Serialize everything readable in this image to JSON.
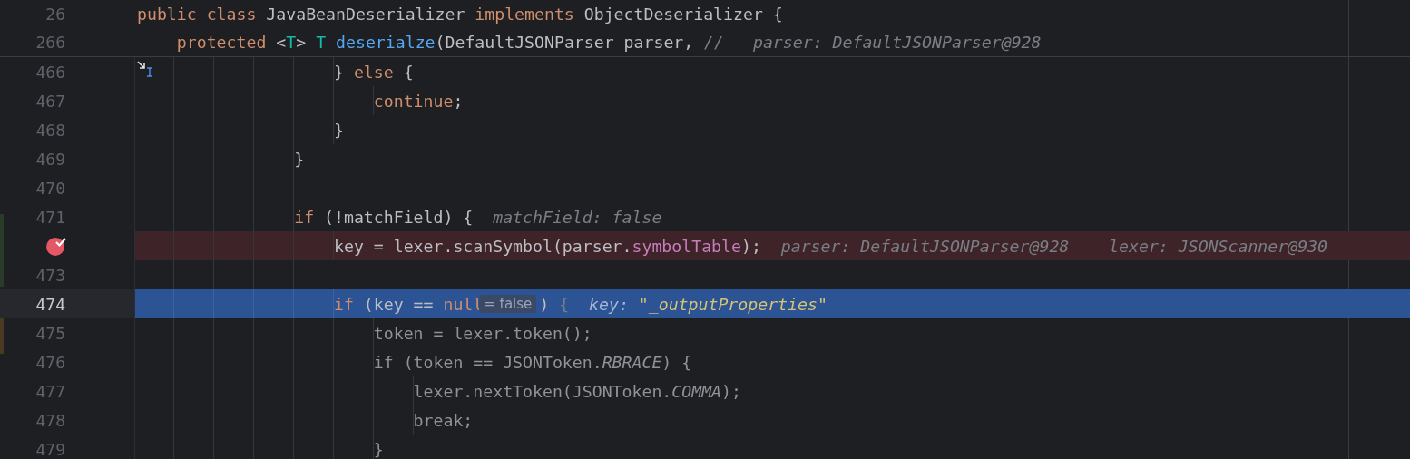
{
  "sticky_lines": [
    {
      "number": "26",
      "tokens": [
        {
          "kind": "keyword",
          "text": "public class "
        },
        {
          "kind": "plain",
          "text": "JavaBeanDeserializer "
        },
        {
          "kind": "keyword",
          "text": "implements "
        },
        {
          "kind": "plain",
          "text": "ObjectDeserializer {"
        }
      ]
    },
    {
      "number": "266",
      "tokens": [
        {
          "kind": "keyword",
          "text": "    protected "
        },
        {
          "kind": "plain",
          "text": "<"
        },
        {
          "kind": "type_param",
          "text": "T"
        },
        {
          "kind": "plain",
          "text": "> "
        },
        {
          "kind": "type_param",
          "text": "T "
        },
        {
          "kind": "method",
          "text": "deserialze"
        },
        {
          "kind": "plain",
          "text": "(DefaultJSONParser parser, "
        },
        {
          "kind": "comment",
          "text": "//"
        },
        {
          "kind": "hint",
          "text": "   parser: DefaultJSONParser@928"
        }
      ]
    }
  ],
  "lines": [
    {
      "number": "466",
      "breakpoint": false,
      "current": false,
      "dimmed": false,
      "cursor": true,
      "tokens": [
        {
          "kind": "plain",
          "text": "                    } "
        },
        {
          "kind": "keyword",
          "text": "else"
        },
        {
          "kind": "plain",
          "text": " {"
        }
      ]
    },
    {
      "number": "467",
      "breakpoint": false,
      "current": false,
      "dimmed": false,
      "cursor": false,
      "tokens": [
        {
          "kind": "keyword",
          "text": "                        continue"
        },
        {
          "kind": "plain",
          "text": ";"
        }
      ]
    },
    {
      "number": "468",
      "breakpoint": false,
      "current": false,
      "dimmed": false,
      "cursor": false,
      "tokens": [
        {
          "kind": "plain",
          "text": "                    }"
        }
      ]
    },
    {
      "number": "469",
      "breakpoint": false,
      "current": false,
      "dimmed": false,
      "cursor": false,
      "tokens": [
        {
          "kind": "plain",
          "text": "                }"
        }
      ]
    },
    {
      "number": "470",
      "breakpoint": false,
      "current": false,
      "cursor": false
    },
    {
      "number": "471",
      "breakpoint": false,
      "current": false,
      "dimmed": false,
      "cursor": false,
      "tokens": [
        {
          "kind": "keyword",
          "text": "                if"
        },
        {
          "kind": "plain",
          "text": " (!matchField) {"
        },
        {
          "kind": "hint",
          "text": "  matchField: false"
        }
      ]
    },
    {
      "breakpoint": true,
      "current": false,
      "dimmed": false,
      "cursor": false,
      "tokens": [
        {
          "kind": "plain",
          "text": "                    key = lexer.scanSymbol(parser."
        },
        {
          "kind": "field",
          "text": "symbolTable"
        },
        {
          "kind": "plain",
          "text": ");"
        },
        {
          "kind": "hint",
          "text": "  parser: DefaultJSONParser@928    lexer: JSONScanner@930"
        }
      ]
    },
    {
      "number": "473",
      "breakpoint": false,
      "current": false,
      "cursor": false
    },
    {
      "number": "474",
      "breakpoint": false,
      "current": true,
      "dimmed": false,
      "cursor": false,
      "tokens": [
        {
          "kind": "keyword",
          "text": "                    if"
        },
        {
          "kind": "plain",
          "text": " (key == "
        },
        {
          "kind": "keyword",
          "text": "null"
        },
        {
          "kind": "chip",
          "text": "= false"
        },
        {
          "kind": "plain",
          "text": ") "
        },
        {
          "kind": "faded",
          "text": "{"
        },
        {
          "kind": "hint",
          "text": "  key: "
        },
        {
          "kind": "hint_string",
          "text": "\"_outputProperties\""
        }
      ]
    },
    {
      "number": "475",
      "breakpoint": false,
      "current": false,
      "dimmed": true,
      "cursor": false,
      "tokens": [
        {
          "kind": "plain",
          "text": "                        token = lexer.token();"
        }
      ]
    },
    {
      "number": "476",
      "breakpoint": false,
      "current": false,
      "dimmed": true,
      "cursor": false,
      "tokens": [
        {
          "kind": "keyword",
          "text": "                        if"
        },
        {
          "kind": "plain",
          "text": " (token == JSONToken."
        },
        {
          "kind": "constant",
          "text": "RBRACE"
        },
        {
          "kind": "plain",
          "text": ") {"
        }
      ]
    },
    {
      "number": "477",
      "breakpoint": false,
      "current": false,
      "dimmed": true,
      "cursor": false,
      "tokens": [
        {
          "kind": "plain",
          "text": "                            lexer.nextToken(JSONToken."
        },
        {
          "kind": "constant",
          "text": "COMMA"
        },
        {
          "kind": "plain",
          "text": ");"
        }
      ]
    },
    {
      "number": "478",
      "breakpoint": false,
      "current": false,
      "dimmed": true,
      "cursor": false,
      "tokens": [
        {
          "kind": "keyword",
          "text": "                            break"
        },
        {
          "kind": "plain",
          "text": ";"
        }
      ]
    },
    {
      "number": "479",
      "breakpoint": false,
      "current": false,
      "dimmed": true,
      "cursor": false,
      "tokens": [
        {
          "kind": "plain",
          "text": "                        }"
        }
      ]
    }
  ]
}
